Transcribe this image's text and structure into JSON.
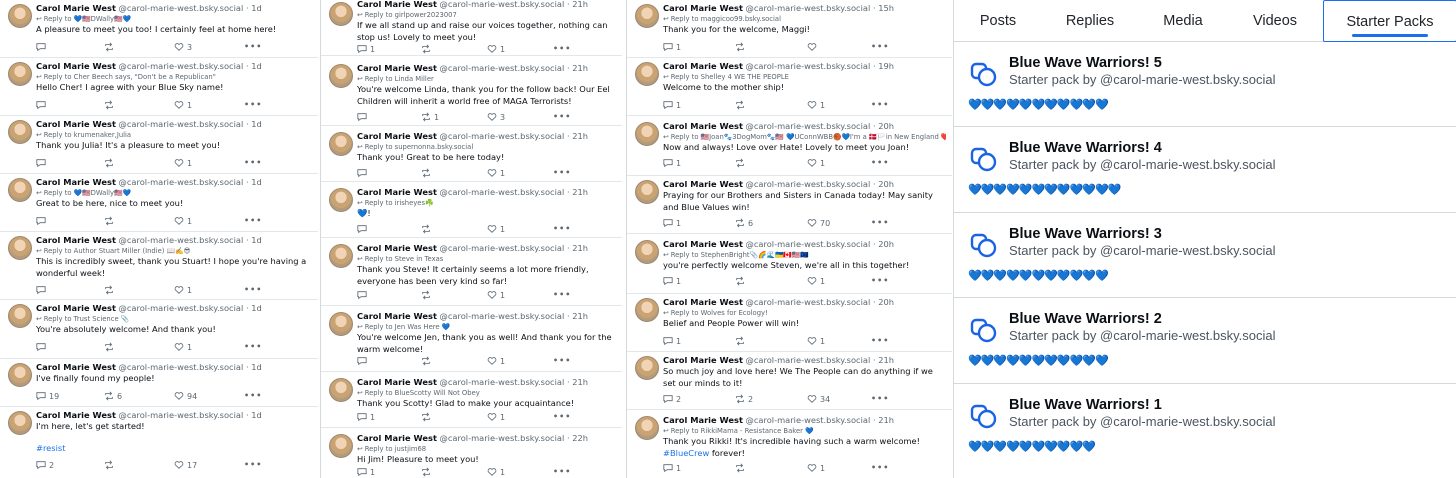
{
  "profile": {
    "name": "Carol Marie West",
    "handle": "@carol-marie-west.bsky.social"
  },
  "columns": [
    {
      "posts": [
        {
          "time": "1d",
          "reply_to": "Reply to 💙🇺🇸DWally🇺🇸💙",
          "text": "A pleasure to meet you too! I certainly feel at home here!",
          "replies": "",
          "reposts": "",
          "likes": "3"
        },
        {
          "time": "1d",
          "reply_to": "Reply to Cher Beech says, \"Don't be a Republican\"",
          "text": "Hello Cher! I agree with your Blue Sky name!",
          "replies": "",
          "reposts": "",
          "likes": "1"
        },
        {
          "time": "1d",
          "reply_to": "Reply to krumenaker,Julia",
          "text": "Thank you Julia! It's a pleasure to meet you!",
          "replies": "",
          "reposts": "",
          "likes": "1"
        },
        {
          "time": "1d",
          "reply_to": "Reply to 💙🇺🇸DWally🇺🇸💙",
          "text": "Great to be here, nice to meet you!",
          "replies": "",
          "reposts": "",
          "likes": "1"
        },
        {
          "time": "1d",
          "reply_to": "Reply to Author Stuart Miller (Indie) 📖✍️😎",
          "text": "This is incredibly sweet, thank you Stuart! I hope you're having a wonderful week!",
          "replies": "",
          "reposts": "",
          "likes": "1"
        },
        {
          "time": "1d",
          "reply_to": "Reply to Trust Science 📎",
          "text": "You're absolutely welcome! And thank you!",
          "replies": "",
          "reposts": "",
          "likes": "1"
        },
        {
          "time": "1d",
          "reply_to": "",
          "text": "I've finally found my people!",
          "replies": "19",
          "reposts": "6",
          "likes": "94"
        },
        {
          "time": "1d",
          "reply_to": "",
          "text": "I'm here, let's get started!",
          "tag": "#resist",
          "replies": "2",
          "reposts": "",
          "likes": "17"
        }
      ]
    },
    {
      "posts": [
        {
          "time": "21h",
          "reply_to": "Reply to girlpower2023007",
          "text": "If we all stand up and raise our voices together, nothing can stop us! Lovely to meet you!",
          "replies": "1",
          "reposts": "",
          "likes": "1"
        },
        {
          "time": "21h",
          "reply_to": "Reply to Linda Miller",
          "text": "You're welcome Linda, thank you for the follow back! Our Eel Children will inherit a world free of MAGA Terrorists!",
          "replies": "",
          "reposts": "1",
          "likes": "3"
        },
        {
          "time": "21h",
          "reply_to": "Reply to supernonna.bsky.social",
          "text": "Thank you! Great to be here today!",
          "replies": "",
          "reposts": "",
          "likes": "1"
        },
        {
          "time": "21h",
          "reply_to": "Reply to irisheyes☘️",
          "text": "💙!",
          "replies": "",
          "reposts": "",
          "likes": "1"
        },
        {
          "time": "21h",
          "reply_to": "Reply to Steve in Texas",
          "text": "Thank you Steve! It certainly seems a lot more friendly, everyone has been very kind so far!",
          "replies": "",
          "reposts": "",
          "likes": "1"
        },
        {
          "time": "21h",
          "reply_to": "Reply to Jen Was Here 💙",
          "text": "You're welcome Jen, thank you as well! And thank you for the warm welcome!",
          "replies": "",
          "reposts": "",
          "likes": "1"
        },
        {
          "time": "21h",
          "reply_to": "Reply to BlueScotty Will Not Obey",
          "text": "Thank you Scotty! Glad to make your acquaintance!",
          "replies": "1",
          "reposts": "",
          "likes": "1"
        },
        {
          "time": "22h",
          "reply_to": "Reply to justjim68",
          "text": "Hi Jim! Pleasure to meet you!",
          "replies": "1",
          "reposts": "",
          "likes": "1"
        }
      ]
    },
    {
      "posts": [
        {
          "time": "15h",
          "reply_to": "Reply to maggicoo99.bsky.social",
          "text": "Thank you for the welcome, Maggi!",
          "replies": "1",
          "reposts": "",
          "likes": ""
        },
        {
          "time": "19h",
          "reply_to": "Reply to Shelley 4 WE THE PEOPLE",
          "text": "Welcome to the mother ship!",
          "replies": "1",
          "reposts": "",
          "likes": "1"
        },
        {
          "time": "20h",
          "reply_to": "Reply to 🇺🇸Joan🐾3DogMom🐾🇺🇸 💙UConnWBB🏀💙I'm a 🇩🇰🏳️in New England ❤️",
          "text": "Now and always! Love over Hate! Lovely to meet you Joan!",
          "replies": "1",
          "reposts": "",
          "likes": "1"
        },
        {
          "time": "20h",
          "reply_to": "",
          "text": "Praying for our Brothers and Sisters in Canada today! May sanity and Blue Values win!",
          "replies": "1",
          "reposts": "6",
          "likes": "70"
        },
        {
          "time": "20h",
          "reply_to": "Reply to StephenBright📎🌈🌊🇺🇦🇨🇦🇺🇸🇪🇺",
          "text": "you're perfectly welcome Steven, we're all in this together!",
          "replies": "1",
          "reposts": "",
          "likes": "1"
        },
        {
          "time": "20h",
          "reply_to": "Reply to Wolves for Ecology!",
          "text": "Belief and People Power will win!",
          "replies": "1",
          "reposts": "",
          "likes": "1"
        },
        {
          "time": "21h",
          "reply_to": "",
          "text": "So much joy and love here! We The People can do anything if we set our minds to it!",
          "replies": "2",
          "reposts": "2",
          "likes": "34"
        },
        {
          "time": "21h",
          "reply_to": "Reply to RikkiMama - Resistance Baker 💙",
          "text": "Thank you Rikki! It's incredible having such a warm welcome!",
          "tag": "#BlueCrew",
          "after_tag": "forever!",
          "replies": "1",
          "reposts": "",
          "likes": "1"
        }
      ]
    }
  ],
  "tabs": {
    "posts": "Posts",
    "replies": "Replies",
    "media": "Media",
    "videos": "Videos",
    "starter_packs": "Starter Packs",
    "active": "Starter Packs"
  },
  "starter_packs": [
    {
      "title": "Blue Wave Warriors! 5",
      "subtitle": "Starter pack by @carol-marie-west.bsky.social",
      "hearts": "💙💙💙💙💙💙💙💙💙💙💙"
    },
    {
      "title": "Blue Wave Warriors! 4",
      "subtitle": "Starter pack by @carol-marie-west.bsky.social",
      "hearts": "💙💙💙💙💙💙💙💙💙💙💙💙"
    },
    {
      "title": "Blue Wave Warriors! 3",
      "subtitle": "Starter pack by @carol-marie-west.bsky.social",
      "hearts": "💙💙💙💙💙💙💙💙💙💙💙"
    },
    {
      "title": "Blue Wave Warriors! 2",
      "subtitle": "Starter pack by @carol-marie-west.bsky.social",
      "hearts": "💙💙💙💙💙💙💙💙💙💙💙"
    },
    {
      "title": "Blue Wave Warriors! 1",
      "subtitle": "Starter pack by @carol-marie-west.bsky.social",
      "hearts": "💙💙💙💙💙💙💙💙💙💙"
    }
  ],
  "colors": {
    "accent": "#1a6ff0",
    "link": "#1a73e8",
    "muted": "#5b6771",
    "heart": "#1b63e6"
  }
}
